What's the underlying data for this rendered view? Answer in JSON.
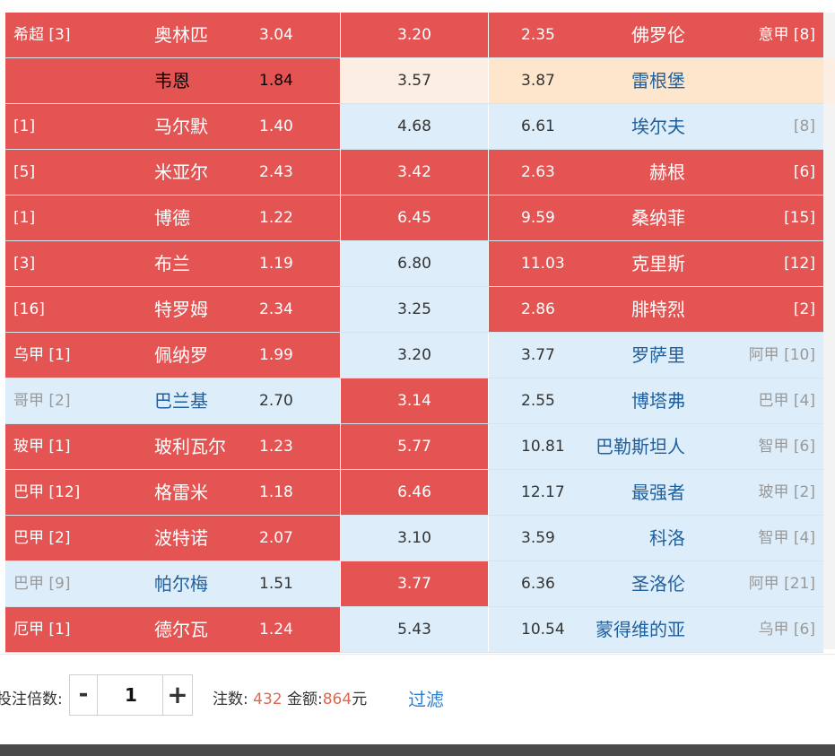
{
  "rows": [
    {
      "c": [
        "red",
        "red",
        "red"
      ],
      "left_league": "希超 [3]",
      "home": "奥林匹",
      "home_odds": "3.04",
      "draw_odds": "3.20",
      "away_odds": "2.35",
      "away": "佛罗伦",
      "right_league": "意甲 [8]"
    },
    {
      "c": [
        "blank",
        "peach",
        "orange"
      ],
      "left_league": "",
      "home": "韦恩",
      "home_odds": "1.84",
      "draw_odds": "3.57",
      "away_odds": "3.87",
      "away": "雷根堡",
      "right_league": ""
    },
    {
      "c": [
        "red",
        "blue",
        "blue"
      ],
      "left_league": "[1]",
      "home": "马尔默",
      "home_odds": "1.40",
      "draw_odds": "4.68",
      "away_odds": "6.61",
      "away": "埃尔夫",
      "right_league": "[8]"
    },
    {
      "c": [
        "red",
        "red",
        "red"
      ],
      "left_league": "[5]",
      "home": "米亚尔",
      "home_odds": "2.43",
      "draw_odds": "3.42",
      "away_odds": "2.63",
      "away": "赫根",
      "right_league": "[6]"
    },
    {
      "c": [
        "red",
        "red",
        "red"
      ],
      "left_league": "[1]",
      "home": "博德",
      "home_odds": "1.22",
      "draw_odds": "6.45",
      "away_odds": "9.59",
      "away": "桑纳菲",
      "right_league": "[15]"
    },
    {
      "c": [
        "red",
        "blue",
        "red"
      ],
      "left_league": "[3]",
      "home": "布兰",
      "home_odds": "1.19",
      "draw_odds": "6.80",
      "away_odds": "11.03",
      "away": "克里斯",
      "right_league": "[12]"
    },
    {
      "c": [
        "red",
        "blue",
        "red"
      ],
      "left_league": "[16]",
      "home": "特罗姆",
      "home_odds": "2.34",
      "draw_odds": "3.25",
      "away_odds": "2.86",
      "away": "腓特烈",
      "right_league": "[2]"
    },
    {
      "c": [
        "red",
        "blue",
        "blue"
      ],
      "left_league": "乌甲 [1]",
      "home": "佩纳罗",
      "home_odds": "1.99",
      "draw_odds": "3.20",
      "away_odds": "3.77",
      "away": "罗萨里",
      "right_league": "阿甲 [10]"
    },
    {
      "c": [
        "blue",
        "red",
        "blue"
      ],
      "left_league": "哥甲 [2]",
      "home": "巴兰基",
      "home_odds": "2.70",
      "draw_odds": "3.14",
      "away_odds": "2.55",
      "away": "博塔弗",
      "right_league": "巴甲 [4]"
    },
    {
      "c": [
        "red",
        "red",
        "blue"
      ],
      "left_league": "玻甲 [1]",
      "home": "玻利瓦尔",
      "home_odds": "1.23",
      "draw_odds": "5.77",
      "away_odds": "10.81",
      "away": "巴勒斯坦人",
      "right_league": "智甲 [6]"
    },
    {
      "c": [
        "red",
        "red",
        "blue"
      ],
      "left_league": "巴甲 [12]",
      "home": "格雷米",
      "home_odds": "1.18",
      "draw_odds": "6.46",
      "away_odds": "12.17",
      "away": "最强者",
      "right_league": "玻甲 [2]"
    },
    {
      "c": [
        "red",
        "blue",
        "blue"
      ],
      "left_league": "巴甲 [2]",
      "home": "波特诺",
      "home_odds": "2.07",
      "draw_odds": "3.10",
      "away_odds": "3.59",
      "away": "科洛",
      "right_league": "智甲 [4]"
    },
    {
      "c": [
        "blue",
        "red",
        "blue"
      ],
      "left_league": "巴甲 [9]",
      "home": "帕尔梅",
      "home_odds": "1.51",
      "draw_odds": "3.77",
      "away_odds": "6.36",
      "away": "圣洛伦",
      "right_league": "阿甲 [21]"
    },
    {
      "c": [
        "red",
        "blue",
        "blue"
      ],
      "left_league": "厄甲 [1]",
      "home": "德尔瓦",
      "home_odds": "1.24",
      "draw_odds": "5.43",
      "away_odds": "10.54",
      "away": "蒙得维的亚",
      "right_league": "乌甲 [6]"
    }
  ],
  "footer": {
    "multiplier_label": "投注倍数:",
    "minus": "-",
    "multiplier_value": "1",
    "plus": "+",
    "bets_label": "注数: ",
    "bets_value": "432",
    "amount_label": " 金额:",
    "amount_value": "864",
    "amount_unit": "元",
    "filter": "过滤"
  },
  "colors": {
    "red": "#e45453",
    "blue": "#ddeefa",
    "peach": "#fdeee4",
    "orange": "#fde6cc",
    "team_blue": "#1f5f9e",
    "count_red": "#e2664f",
    "link": "#2d7fcf"
  }
}
